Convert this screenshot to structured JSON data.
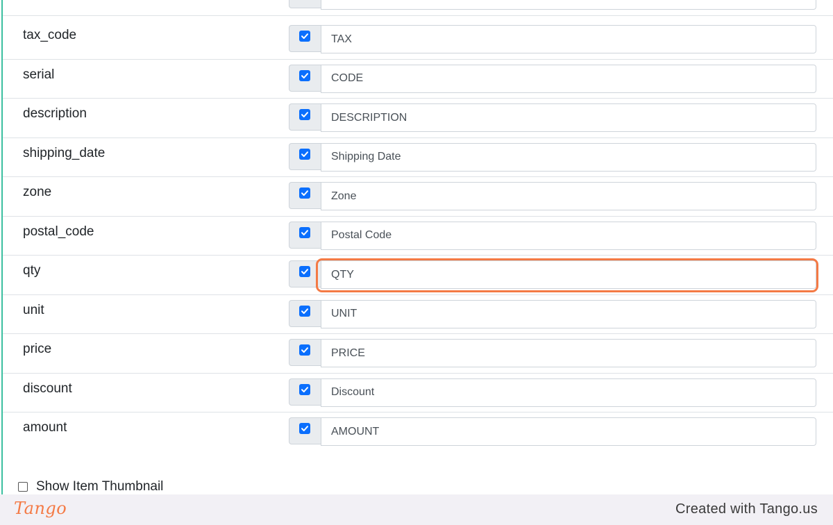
{
  "rows": [
    {
      "key": "",
      "checked": true,
      "value": "#"
    },
    {
      "key": "tax_code",
      "checked": true,
      "value": "TAX"
    },
    {
      "key": "serial",
      "checked": true,
      "value": "CODE"
    },
    {
      "key": "description",
      "checked": true,
      "value": "DESCRIPTION"
    },
    {
      "key": "shipping_date",
      "checked": true,
      "value": "Shipping Date"
    },
    {
      "key": "zone",
      "checked": true,
      "value": "Zone"
    },
    {
      "key": "postal_code",
      "checked": true,
      "value": "Postal Code"
    },
    {
      "key": "qty",
      "checked": true,
      "value": "QTY"
    },
    {
      "key": "unit",
      "checked": true,
      "value": "UNIT"
    },
    {
      "key": "price",
      "checked": true,
      "value": "PRICE"
    },
    {
      "key": "discount",
      "checked": true,
      "value": "Discount"
    },
    {
      "key": "amount",
      "checked": true,
      "value": "AMOUNT"
    }
  ],
  "thumbnail_option": {
    "label": "Show Item Thumbnail",
    "checked": false
  },
  "footer": {
    "logo": "Tango",
    "credit": "Created with Tango.us"
  },
  "colors": {
    "accent_check": "#0b6ffd",
    "highlight": "#f47a45",
    "panel_border": "#3bbfa0"
  }
}
